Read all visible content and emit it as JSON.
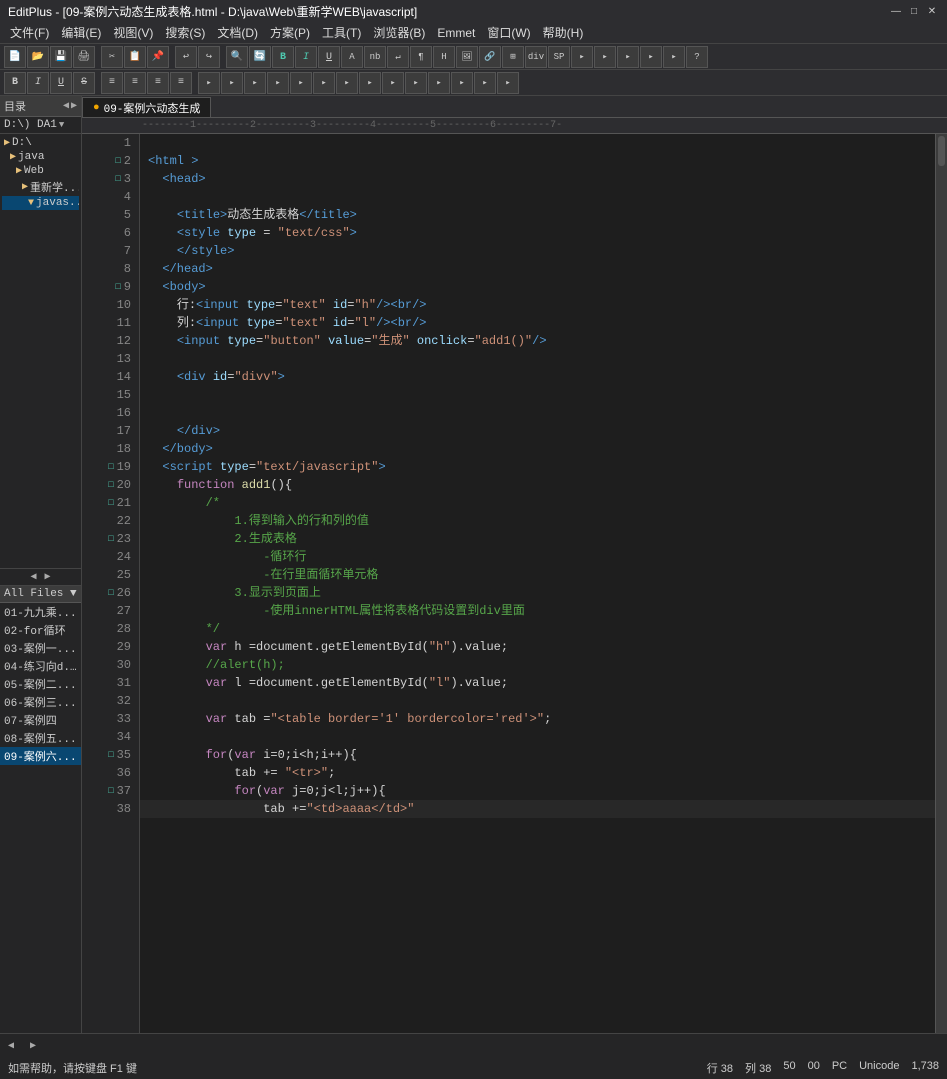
{
  "titleBar": {
    "title": "EditPlus - [09-案例六动态生成表格.html - D:\\java\\Web\\重新学WEB\\javascript]",
    "minimize": "—",
    "maximize": "□",
    "close": "✕"
  },
  "menuBar": {
    "items": [
      "文件(F)",
      "编辑(E)",
      "视图(V)",
      "搜索(S)",
      "文档(D)",
      "方案(P)",
      "工具(T)",
      "浏览器(B)",
      "Emmet",
      "窗口(W)",
      "帮助(H)"
    ]
  },
  "dirHeader": {
    "label": "目录",
    "nav": [
      "◀",
      "▶"
    ]
  },
  "dirTree": {
    "drive": "D:\\) DA1",
    "items": [
      {
        "label": "D:\\",
        "type": "folder",
        "expanded": true
      },
      {
        "label": "java",
        "type": "folder",
        "indent": 1
      },
      {
        "label": "Web",
        "type": "folder",
        "indent": 2
      },
      {
        "label": "重新学...",
        "type": "folder",
        "indent": 3
      },
      {
        "label": "javas...",
        "type": "folder",
        "indent": 4,
        "selected": true
      }
    ]
  },
  "fileList": {
    "label": "All Files ▼",
    "items": [
      {
        "label": "01-九九乘...",
        "selected": false
      },
      {
        "label": "02-for循环",
        "selected": false
      },
      {
        "label": "03-案例一...",
        "selected": false
      },
      {
        "label": "04-练习向d...",
        "selected": false
      },
      {
        "label": "05-案例二...",
        "selected": false
      },
      {
        "label": "06-案例三...",
        "selected": false
      },
      {
        "label": "07-案例四",
        "selected": false
      },
      {
        "label": "08-案例五...",
        "selected": false
      },
      {
        "label": "09-案例六...",
        "selected": true
      }
    ]
  },
  "tab": {
    "label": "09-案例六动态生成",
    "dotIcon": "●"
  },
  "ruler": {
    "text": "--------1---------2---------3---------4---------5---------6---------7-"
  },
  "codeLines": [
    {
      "num": 1,
      "fold": "",
      "content": ""
    },
    {
      "num": 2,
      "fold": "□",
      "content": "<html >"
    },
    {
      "num": 3,
      "fold": "□",
      "content": "  <head>"
    },
    {
      "num": 4,
      "fold": "",
      "content": ""
    },
    {
      "num": 5,
      "fold": "",
      "content": "    <title>动态生成表格</title>"
    },
    {
      "num": 6,
      "fold": "",
      "content": "    <style type = \"text/css\">"
    },
    {
      "num": 7,
      "fold": "",
      "content": "    </style>"
    },
    {
      "num": 8,
      "fold": "",
      "content": "  </head>"
    },
    {
      "num": 9,
      "fold": "□",
      "content": "  <body>"
    },
    {
      "num": 10,
      "fold": "",
      "content": "    行:<input type=\"text\" id=\"h\"/><br/>"
    },
    {
      "num": 11,
      "fold": "",
      "content": "    列:<input type=\"text\" id=\"l\"/><br/>"
    },
    {
      "num": 12,
      "fold": "",
      "content": "    <input type=\"button\" value=\"生成\" onclick=\"add1()\"/>"
    },
    {
      "num": 13,
      "fold": "",
      "content": ""
    },
    {
      "num": 14,
      "fold": "",
      "content": "    <div id=\"divv\">"
    },
    {
      "num": 15,
      "fold": "",
      "content": ""
    },
    {
      "num": 16,
      "fold": "",
      "content": ""
    },
    {
      "num": 17,
      "fold": "",
      "content": "    </div>"
    },
    {
      "num": 18,
      "fold": "",
      "content": "  </body>"
    },
    {
      "num": 19,
      "fold": "□",
      "content": "  <script type=\"text/javascript\">"
    },
    {
      "num": 20,
      "fold": "□",
      "content": "    function add1(){"
    },
    {
      "num": 21,
      "fold": "□",
      "content": "        /*"
    },
    {
      "num": 22,
      "fold": "",
      "content": "            1.得到输入的行和列的值"
    },
    {
      "num": 23,
      "fold": "□",
      "content": "            2.生成表格"
    },
    {
      "num": 24,
      "fold": "",
      "content": "                -循环行"
    },
    {
      "num": 25,
      "fold": "",
      "content": "                -在行里面循环单元格"
    },
    {
      "num": 26,
      "fold": "□",
      "content": "            3.显示到页面上"
    },
    {
      "num": 27,
      "fold": "",
      "content": "                -使用innerHTML属性将表格代码设置到div里面"
    },
    {
      "num": 28,
      "fold": "",
      "content": "        */"
    },
    {
      "num": 29,
      "fold": "",
      "content": "        var h =document.getElementById(\"h\").value;"
    },
    {
      "num": 30,
      "fold": "",
      "content": "        //alert(h);"
    },
    {
      "num": 31,
      "fold": "",
      "content": "        var l =document.getElementById(\"l\").value;"
    },
    {
      "num": 32,
      "fold": "",
      "content": ""
    },
    {
      "num": 33,
      "fold": "",
      "content": "        var tab =\"<table border='1' bordercolor='red'>\";"
    },
    {
      "num": 34,
      "fold": "",
      "content": ""
    },
    {
      "num": 35,
      "fold": "□",
      "content": "        for(var i=0;i<h;i++){"
    },
    {
      "num": 36,
      "fold": "",
      "content": "            tab += \"<tr>\";"
    },
    {
      "num": 37,
      "fold": "□",
      "content": "            for(var j=0;j<l;j++){"
    },
    {
      "num": 38,
      "fold": "",
      "content": "                tab +=\"<td>aaaa</td>\""
    }
  ],
  "statusBar": {
    "help": "如需帮助，请按键盘 F1 键",
    "row": "行 38",
    "col": "列 38",
    "num50": "50",
    "num00": "00",
    "pc": "PC",
    "encoding": "Unicode",
    "fileCount": "1,738"
  }
}
